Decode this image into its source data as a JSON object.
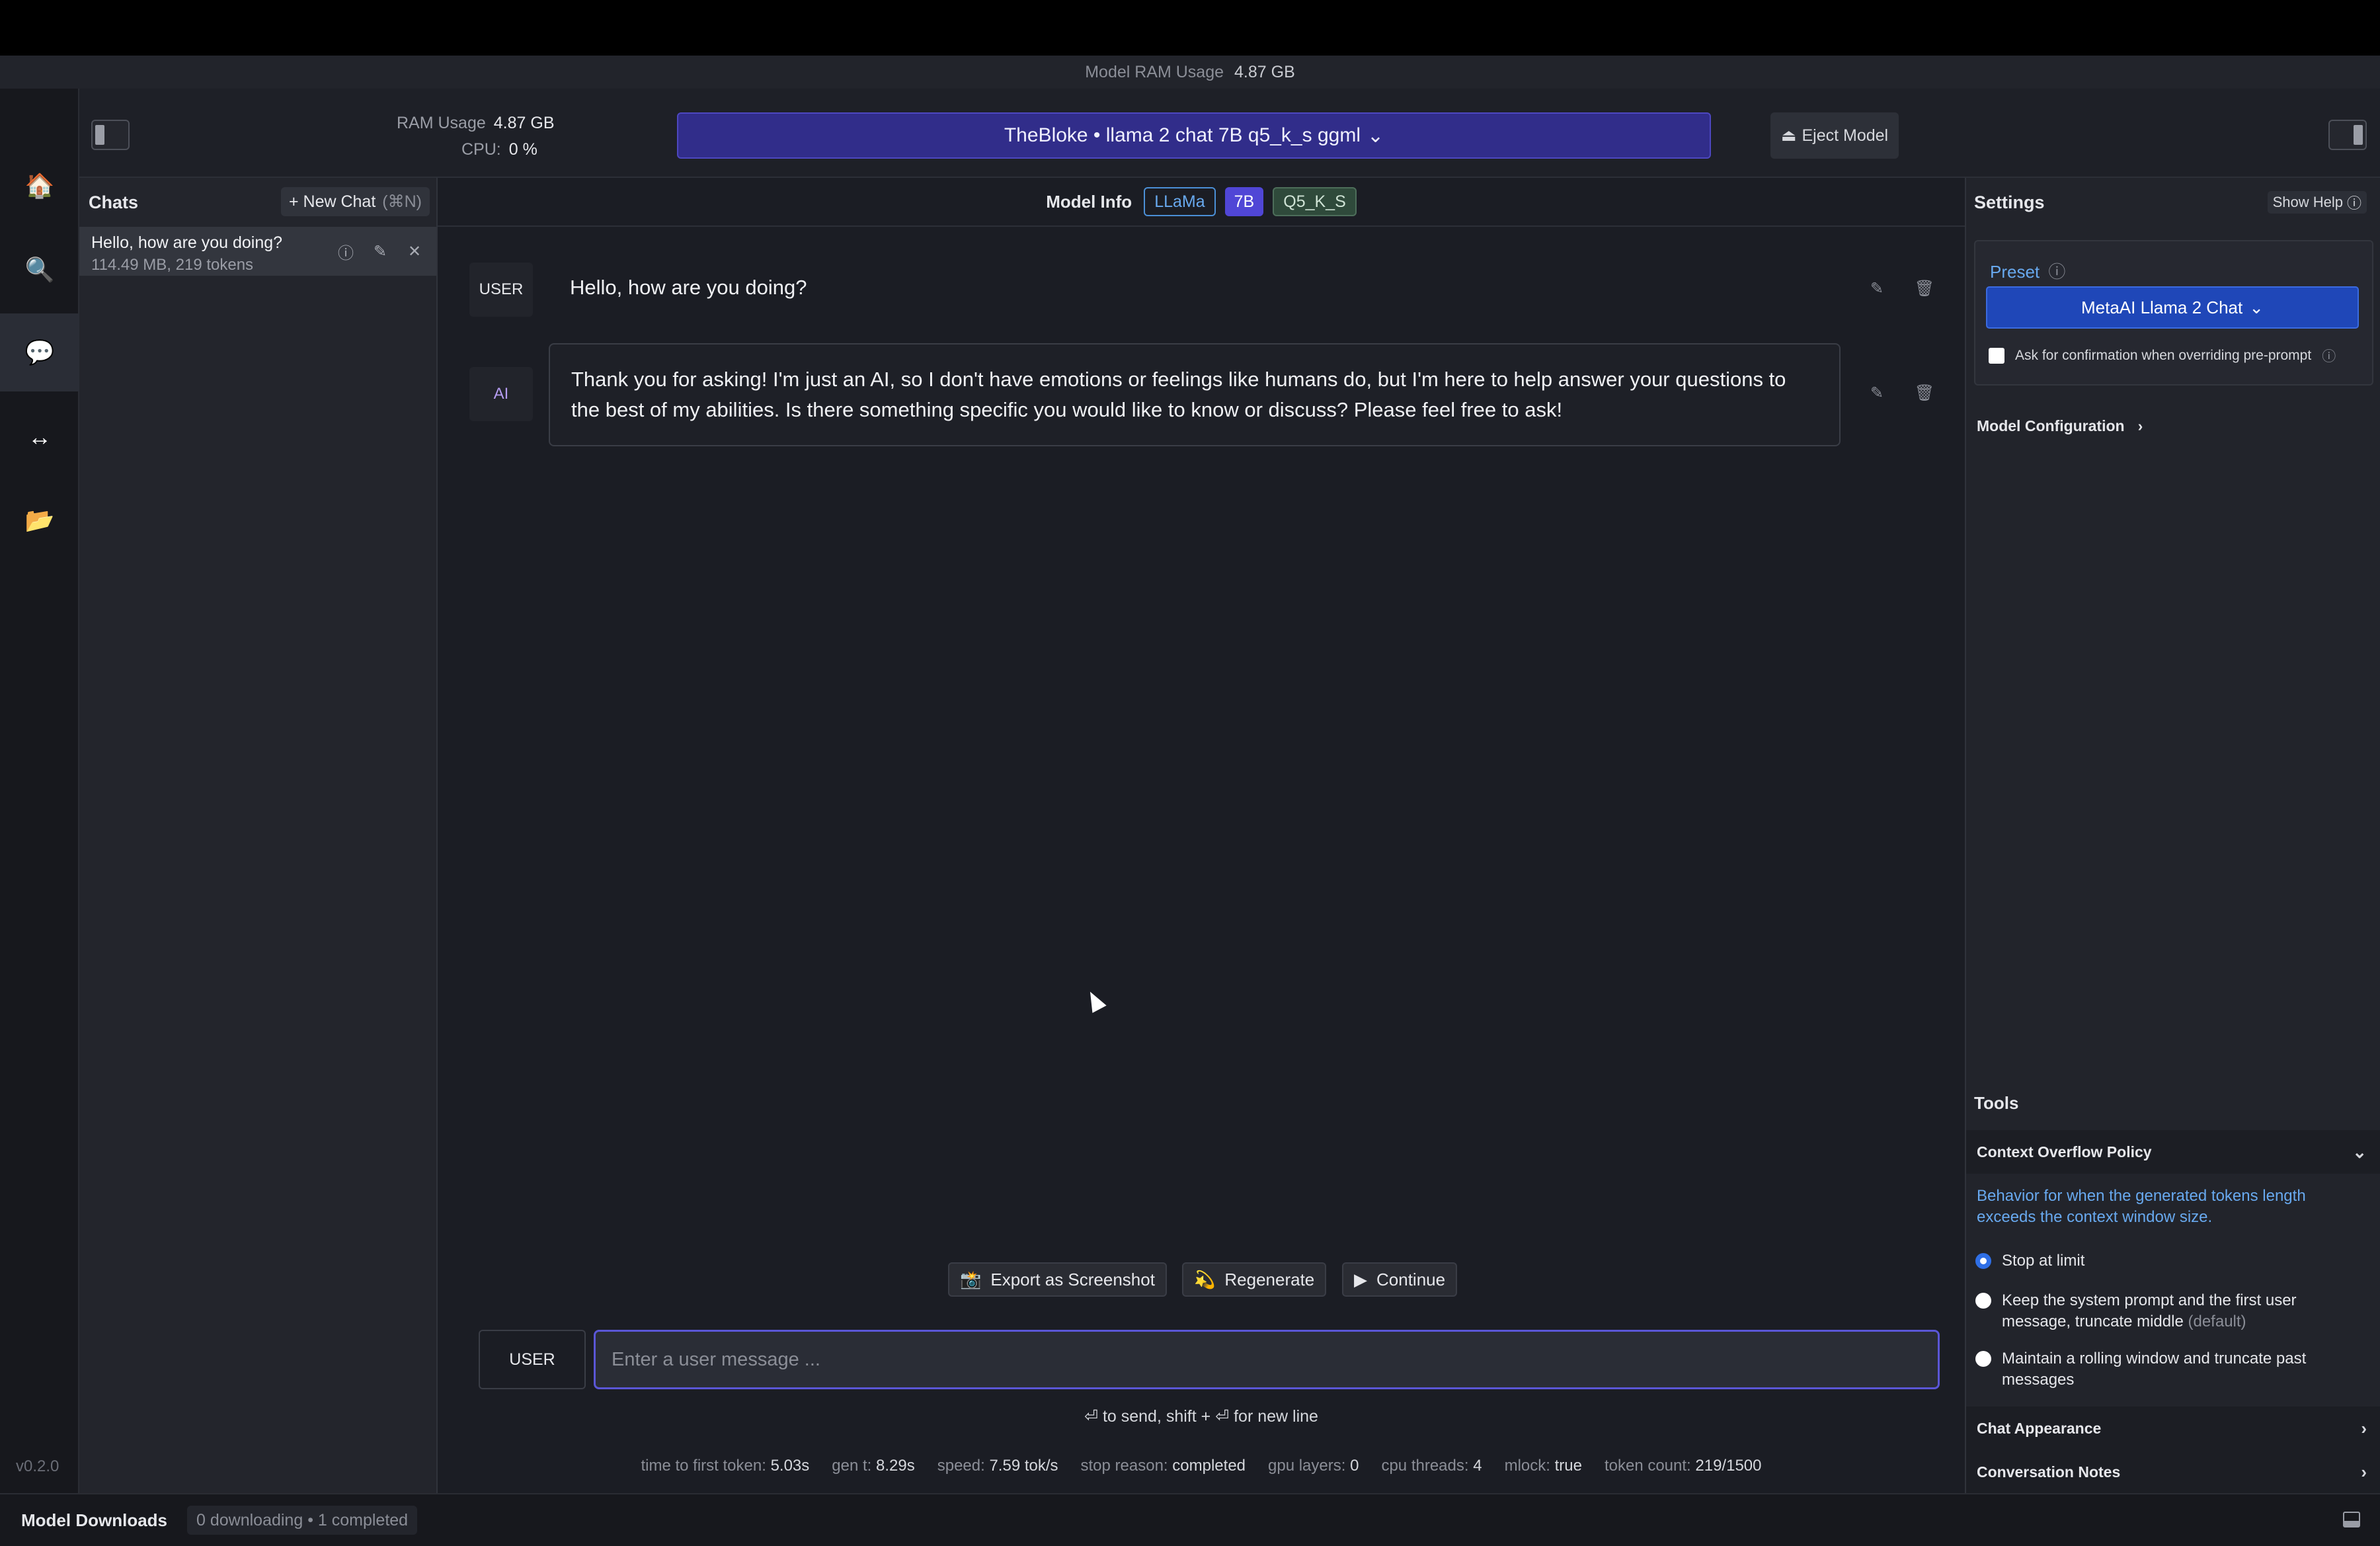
{
  "top_strip": {
    "label": "Model RAM Usage",
    "value": "4.87 GB"
  },
  "header": {
    "ram_label": "RAM Usage",
    "ram_value": "4.87 GB",
    "cpu_label": "CPU:",
    "cpu_value": "0 %",
    "model_select": "TheBloke • llama 2 chat 7B q5_k_s ggml",
    "eject_label": "Eject Model"
  },
  "rail": {
    "items": [
      "home-icon",
      "search-icon",
      "chat-icon",
      "transfer-icon",
      "folder-icon"
    ],
    "version": "v0.2.0"
  },
  "chats": {
    "title": "Chats",
    "new_chat_label": "+ New Chat",
    "new_chat_shortcut": "(⌘N)",
    "items": [
      {
        "title": "Hello, how are you doing?",
        "meta": "114.49 MB, 219 tokens"
      }
    ]
  },
  "model_info": {
    "label": "Model Info",
    "tags": [
      "LLaMa",
      "7B",
      "Q5_K_S"
    ]
  },
  "messages": [
    {
      "role": "USER",
      "text": "Hello, how are you doing?"
    },
    {
      "role": "AI",
      "text": "Thank you for asking! I'm just an AI, so I don't have emotions or feelings like humans do, but I'm here to help answer your questions to the best of my abilities. Is there something specific you would like to know or discuss? Please feel free to ask!"
    }
  ],
  "actions": {
    "export": "Export as Screenshot",
    "regenerate": "Regenerate",
    "continue": "Continue"
  },
  "composer": {
    "role": "USER",
    "placeholder": "Enter a user message ...",
    "hint": "⏎ to send, shift + ⏎ for new line"
  },
  "stats": [
    {
      "label": "time to first token:",
      "value": "5.03s"
    },
    {
      "label": "gen t:",
      "value": "8.29s"
    },
    {
      "label": "speed:",
      "value": "7.59 tok/s"
    },
    {
      "label": "stop reason:",
      "value": "completed"
    },
    {
      "label": "gpu layers:",
      "value": "0"
    },
    {
      "label": "cpu threads:",
      "value": "4"
    },
    {
      "label": "mlock:",
      "value": "true"
    },
    {
      "label": "token count:",
      "value": "219/1500"
    }
  ],
  "settings": {
    "title": "Settings",
    "show_help": "Show Help",
    "preset_label": "Preset",
    "preset_value": "MetaAI Llama 2 Chat",
    "confirm_label": "Ask for confirmation when overriding pre-prompt",
    "model_config": "Model Configuration",
    "tools_label": "Tools",
    "context_overflow": {
      "title": "Context Overflow Policy",
      "description": "Behavior for when the generated tokens length exceeds the context window size.",
      "options": [
        {
          "label": "Stop at limit",
          "selected": true
        },
        {
          "label": "Keep the system prompt and the first user message, truncate middle",
          "suffix": "(default)",
          "selected": false
        },
        {
          "label": "Maintain a rolling window and truncate past messages",
          "selected": false
        }
      ]
    },
    "chat_appearance": "Chat Appearance",
    "conversation_notes": "Conversation Notes"
  },
  "bottom": {
    "title": "Model Downloads",
    "status": "0 downloading • 1 completed"
  },
  "colors": {
    "accent": "#5046d6",
    "model_select_bg": "#312d8a",
    "preset_bg": "#1f47b8",
    "link_blue": "#68a9ef"
  }
}
